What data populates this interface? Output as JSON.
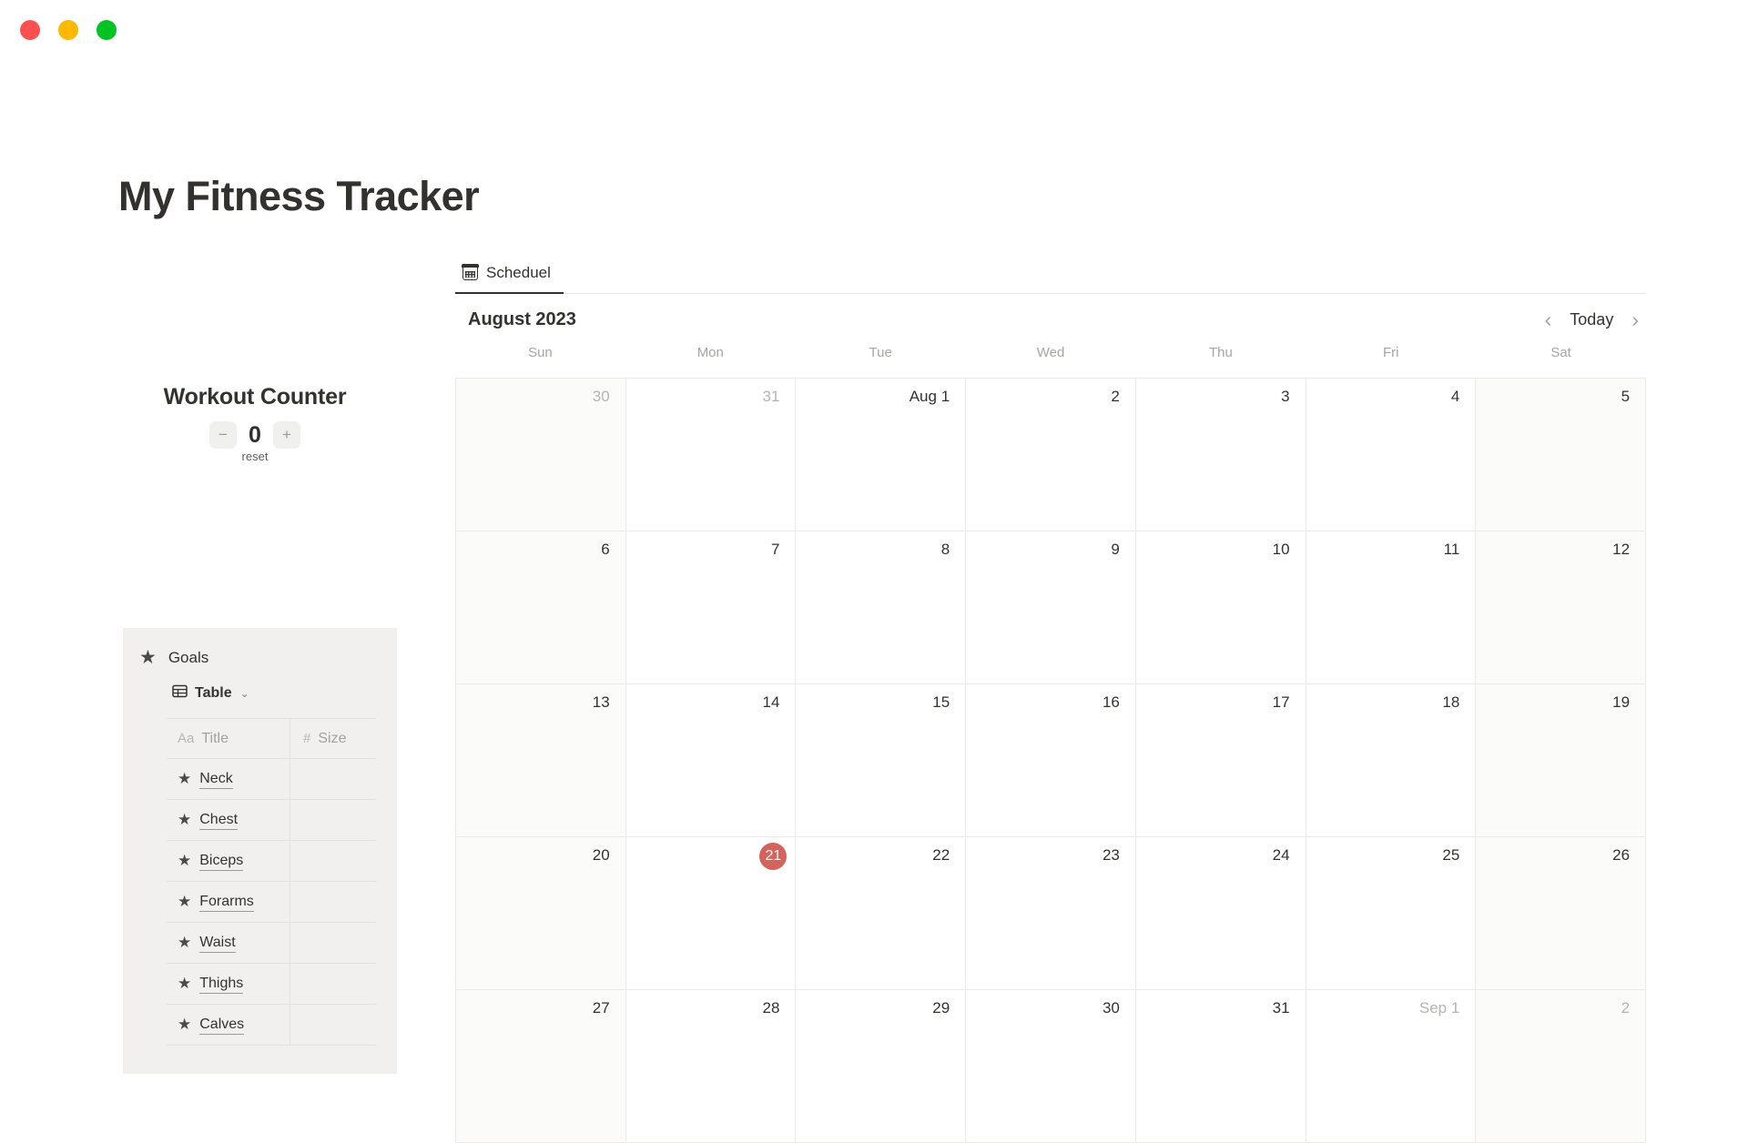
{
  "window": {
    "controls": [
      {
        "name": "close",
        "color": "#ff4f4f"
      },
      {
        "name": "minimize",
        "color": "#ffb800"
      },
      {
        "name": "maximize",
        "color": "#00c421"
      }
    ]
  },
  "page": {
    "title": "My Fitness Tracker"
  },
  "workout_counter": {
    "title": "Workout Counter",
    "decrement_label": "−",
    "value": "0",
    "increment_label": "+",
    "reset_label": "reset"
  },
  "goals": {
    "title": "Goals",
    "star_icon": "★",
    "view_label": "Table",
    "view_caret": "⌄",
    "columns": [
      {
        "type_glyph": "Aa",
        "label": "Title"
      },
      {
        "type_glyph": "#",
        "label": "Size"
      }
    ],
    "rows": [
      {
        "title": "Neck",
        "size": ""
      },
      {
        "title": "Chest",
        "size": ""
      },
      {
        "title": "Biceps",
        "size": ""
      },
      {
        "title": "Forarms",
        "size": ""
      },
      {
        "title": "Waist",
        "size": ""
      },
      {
        "title": "Thighs",
        "size": ""
      },
      {
        "title": "Calves",
        "size": ""
      }
    ]
  },
  "main": {
    "tabs": [
      {
        "label": "Scheduel",
        "icon": "calendar-icon",
        "active": true
      }
    ],
    "calendar": {
      "month_label": "August 2023",
      "nav": {
        "prev_label": "‹",
        "today_label": "Today",
        "next_label": "›"
      },
      "weekdays": [
        "Sun",
        "Mon",
        "Tue",
        "Wed",
        "Thu",
        "Fri",
        "Sat"
      ],
      "today_accent": "#d6625c",
      "weeks": [
        [
          {
            "label": "30",
            "other_month": true,
            "weekend": true,
            "today": false
          },
          {
            "label": "31",
            "other_month": true,
            "weekend": false,
            "today": false
          },
          {
            "label": "Aug 1",
            "other_month": false,
            "weekend": false,
            "today": false
          },
          {
            "label": "2",
            "other_month": false,
            "weekend": false,
            "today": false
          },
          {
            "label": "3",
            "other_month": false,
            "weekend": false,
            "today": false
          },
          {
            "label": "4",
            "other_month": false,
            "weekend": false,
            "today": false
          },
          {
            "label": "5",
            "other_month": false,
            "weekend": true,
            "today": false
          }
        ],
        [
          {
            "label": "6",
            "other_month": false,
            "weekend": true,
            "today": false
          },
          {
            "label": "7",
            "other_month": false,
            "weekend": false,
            "today": false
          },
          {
            "label": "8",
            "other_month": false,
            "weekend": false,
            "today": false
          },
          {
            "label": "9",
            "other_month": false,
            "weekend": false,
            "today": false
          },
          {
            "label": "10",
            "other_month": false,
            "weekend": false,
            "today": false
          },
          {
            "label": "11",
            "other_month": false,
            "weekend": false,
            "today": false
          },
          {
            "label": "12",
            "other_month": false,
            "weekend": true,
            "today": false
          }
        ],
        [
          {
            "label": "13",
            "other_month": false,
            "weekend": true,
            "today": false
          },
          {
            "label": "14",
            "other_month": false,
            "weekend": false,
            "today": false
          },
          {
            "label": "15",
            "other_month": false,
            "weekend": false,
            "today": false
          },
          {
            "label": "16",
            "other_month": false,
            "weekend": false,
            "today": false
          },
          {
            "label": "17",
            "other_month": false,
            "weekend": false,
            "today": false
          },
          {
            "label": "18",
            "other_month": false,
            "weekend": false,
            "today": false
          },
          {
            "label": "19",
            "other_month": false,
            "weekend": true,
            "today": false
          }
        ],
        [
          {
            "label": "20",
            "other_month": false,
            "weekend": true,
            "today": false
          },
          {
            "label": "21",
            "other_month": false,
            "weekend": false,
            "today": true
          },
          {
            "label": "22",
            "other_month": false,
            "weekend": false,
            "today": false
          },
          {
            "label": "23",
            "other_month": false,
            "weekend": false,
            "today": false
          },
          {
            "label": "24",
            "other_month": false,
            "weekend": false,
            "today": false
          },
          {
            "label": "25",
            "other_month": false,
            "weekend": false,
            "today": false
          },
          {
            "label": "26",
            "other_month": false,
            "weekend": true,
            "today": false
          }
        ],
        [
          {
            "label": "27",
            "other_month": false,
            "weekend": true,
            "today": false
          },
          {
            "label": "28",
            "other_month": false,
            "weekend": false,
            "today": false
          },
          {
            "label": "29",
            "other_month": false,
            "weekend": false,
            "today": false
          },
          {
            "label": "30",
            "other_month": false,
            "weekend": false,
            "today": false
          },
          {
            "label": "31",
            "other_month": false,
            "weekend": false,
            "today": false
          },
          {
            "label": "Sep 1",
            "other_month": true,
            "weekend": false,
            "today": false
          },
          {
            "label": "2",
            "other_month": true,
            "weekend": true,
            "today": false
          }
        ]
      ]
    }
  }
}
